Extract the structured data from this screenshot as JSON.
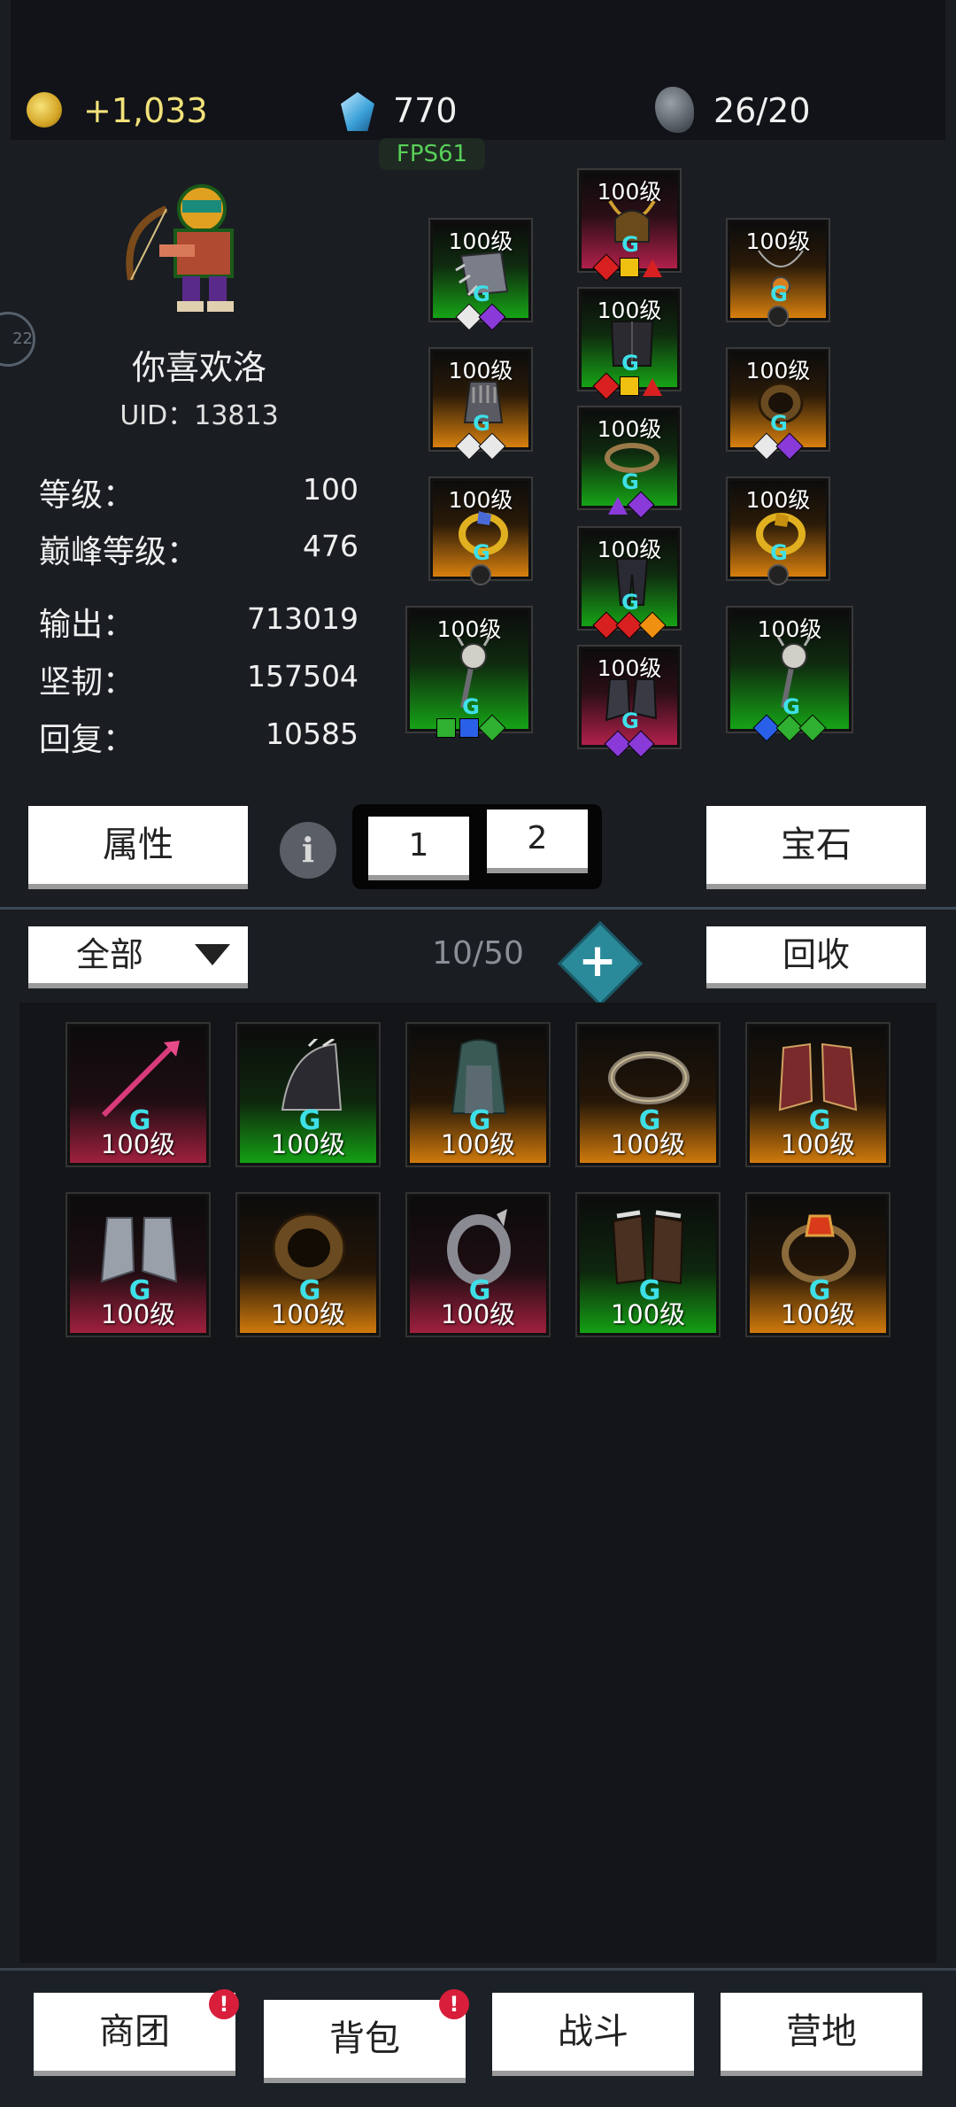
{
  "resources": {
    "gold": "+1,033",
    "diamonds": "770",
    "stamina": "26/20",
    "fps": "FPS61",
    "side_badge": "22"
  },
  "character": {
    "name": "你喜欢洛",
    "uid": "UID：13813",
    "stats": [
      {
        "label": "等级：",
        "value": "100"
      },
      {
        "label": "巅峰等级：",
        "value": "476"
      },
      {
        "label": "输出：",
        "value": "713019"
      },
      {
        "label": "坚韧：",
        "value": "157504"
      },
      {
        "label": "回复：",
        "value": "10585"
      }
    ]
  },
  "equipment": [
    {
      "slot": "bracer",
      "level": "100级",
      "rarity": "green",
      "icon": "spiked-bracer-icon"
    },
    {
      "slot": "helmet",
      "level": "100级",
      "rarity": "red",
      "icon": "horned-helmet-icon"
    },
    {
      "slot": "necklace",
      "level": "100级",
      "rarity": "orange",
      "icon": "amulet-icon"
    },
    {
      "slot": "gloves",
      "level": "100级",
      "rarity": "orange",
      "icon": "gauntlet-icon"
    },
    {
      "slot": "armor",
      "level": "100级",
      "rarity": "green",
      "icon": "chest-armor-icon"
    },
    {
      "slot": "bracelet",
      "level": "100级",
      "rarity": "orange",
      "icon": "bracelet-icon"
    },
    {
      "slot": "ring-left",
      "level": "100级",
      "rarity": "orange",
      "icon": "gold-ring-icon"
    },
    {
      "slot": "belt",
      "level": "100级",
      "rarity": "green",
      "icon": "belt-icon"
    },
    {
      "slot": "ring-right",
      "level": "100级",
      "rarity": "orange",
      "icon": "gold-ring-icon"
    },
    {
      "slot": "pants",
      "level": "100级",
      "rarity": "green",
      "icon": "leg-armor-icon"
    },
    {
      "slot": "weapon-left",
      "level": "100级",
      "rarity": "green",
      "icon": "skull-staff-icon"
    },
    {
      "slot": "boots",
      "level": "100级",
      "rarity": "red",
      "icon": "boots-icon"
    },
    {
      "slot": "weapon-right",
      "level": "100级",
      "rarity": "green",
      "icon": "skull-staff-icon"
    }
  ],
  "buttons": {
    "attributes": "属性",
    "info": "i",
    "set1": "1",
    "set2": "2",
    "gems": "宝石",
    "filter": "全部",
    "capacity": "10/50",
    "recycle": "回收"
  },
  "inventory": [
    {
      "level": "100级",
      "rarity": "red",
      "icon": "red-spear-icon"
    },
    {
      "level": "100级",
      "rarity": "green",
      "icon": "dark-shoulder-icon"
    },
    {
      "level": "100级",
      "rarity": "orange",
      "icon": "hooded-robe-icon"
    },
    {
      "level": "100级",
      "rarity": "orange",
      "icon": "silver-bracelet-icon"
    },
    {
      "level": "100级",
      "rarity": "orange",
      "icon": "red-boots-icon"
    },
    {
      "level": "100级",
      "rarity": "red",
      "icon": "fur-boots-icon"
    },
    {
      "level": "100级",
      "rarity": "orange",
      "icon": "wood-bracelet-icon"
    },
    {
      "level": "100级",
      "rarity": "red",
      "icon": "dark-ring-icon"
    },
    {
      "level": "100级",
      "rarity": "green",
      "icon": "leather-gloves-icon"
    },
    {
      "level": "100级",
      "rarity": "orange",
      "icon": "ruby-ring-icon"
    }
  ],
  "nav": [
    {
      "label": "商团",
      "badge": "!"
    },
    {
      "label": "背包",
      "badge": "!"
    },
    {
      "label": "战斗",
      "badge": ""
    },
    {
      "label": "营地",
      "badge": ""
    }
  ],
  "colors": {
    "green_rarity": "#16a316",
    "orange_rarity": "#d8800e",
    "red_rarity": "#b0204a",
    "gold_text": "#f2e27a",
    "fps_text": "#58d058"
  }
}
